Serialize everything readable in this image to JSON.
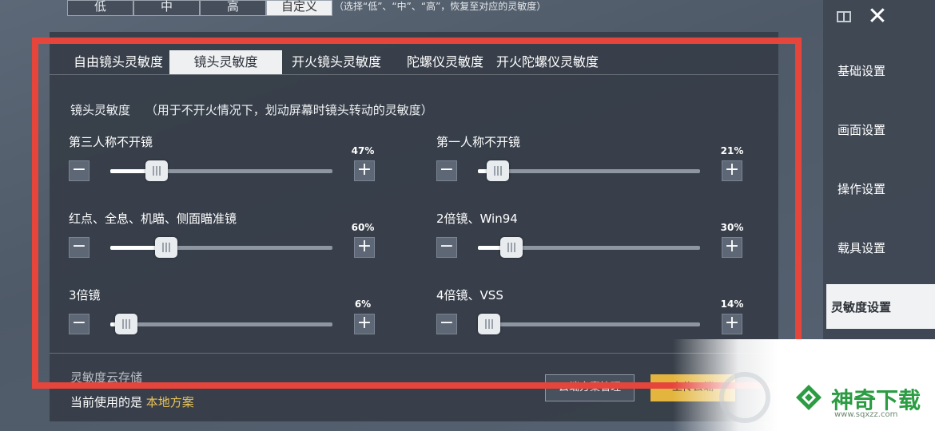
{
  "presets": {
    "options": [
      "低",
      "中",
      "高",
      "自定义"
    ],
    "selected": "自定义",
    "hint": "（选择“低”、“中”、“高”，恢复至对应的灵敏度）"
  },
  "tabs": [
    {
      "label": "自由镜头灵敏度",
      "active": false
    },
    {
      "label": "镜头灵敏度",
      "active": true
    },
    {
      "label": "开火镜头灵敏度",
      "active": false
    },
    {
      "label": "陀螺仪灵敏度",
      "active": false
    },
    {
      "label": "开火陀螺仪灵敏度",
      "active": false
    }
  ],
  "section": {
    "title": "镜头灵敏度",
    "note": "（用于不开火情况下，划动屏幕时镜头转动的灵敏度）"
  },
  "sliders": [
    {
      "label": "第三人称不开镜",
      "value": "47%",
      "level": 0.16
    },
    {
      "label": "第一人称不开镜",
      "value": "21%",
      "level": 0.04
    },
    {
      "label": "红点、全息、机瞄、侧面瞄准镜",
      "value": "60%",
      "level": 0.2
    },
    {
      "label": "2倍镜、Win94",
      "value": "30%",
      "level": 0.1
    },
    {
      "label": "3倍镜",
      "value": "6%",
      "level": 0.02
    },
    {
      "label": "4倍镜、VSS",
      "value": "14%",
      "level": 0.0
    }
  ],
  "stepper_symbols": {
    "minus": "−",
    "plus": "+"
  },
  "footer": {
    "title": "灵敏度云存储",
    "current_prefix": "当前使用的是",
    "current_plan": "本地方案",
    "cloud_button": "云端方案管理",
    "upload_button": "上传云端"
  },
  "side_menu": {
    "items": [
      "基础设置",
      "画面设置",
      "操作设置",
      "载具设置",
      "灵敏度设置"
    ],
    "active": "灵敏度设置",
    "close_symbol": "✕"
  },
  "watermark": {
    "name": "神奇下载",
    "url": "www.sqxzz.com"
  },
  "colors": {
    "highlight_frame": "#e6453c",
    "local_plan": "#e8c35a",
    "upload": "#e3b53e",
    "watermark_green": "#2c9c43"
  }
}
